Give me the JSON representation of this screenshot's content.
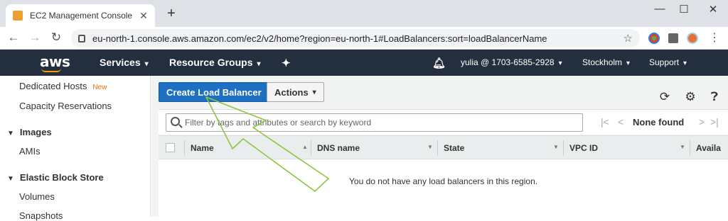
{
  "browser": {
    "tab_title": "EC2 Management Console",
    "tab_close": "✕",
    "new_tab": "+",
    "url": "eu-north-1.console.aws.amazon.com/ec2/v2/home?region=eu-north-1#LoadBalancers:sort=loadBalancerName",
    "window_controls": {
      "minimize": "—",
      "maximize": "☐",
      "close": "✕"
    },
    "nav": {
      "back": "←",
      "forward": "→",
      "reload": "↻"
    }
  },
  "aws_nav": {
    "logo": "aws",
    "services": "Services",
    "resource_groups": "Resource Groups",
    "account": "yulia @ 1703-6585-2928",
    "region": "Stockholm",
    "support": "Support"
  },
  "sidebar": {
    "items": [
      {
        "label": "Dedicated Hosts",
        "badge": "New"
      },
      {
        "label": "Capacity Reservations"
      }
    ],
    "sections": [
      {
        "title": "Images",
        "items": [
          {
            "label": "AMIs"
          }
        ]
      },
      {
        "title": "Elastic Block Store",
        "items": [
          {
            "label": "Volumes"
          },
          {
            "label": "Snapshots"
          }
        ]
      }
    ]
  },
  "toolbar": {
    "create_label": "Create Load Balancer",
    "actions_label": "Actions"
  },
  "filter": {
    "placeholder": "Filter by tags and attributes or search by keyword",
    "pager_text": "None found"
  },
  "table": {
    "columns": [
      "Name",
      "DNS name",
      "State",
      "VPC ID",
      "Availa"
    ],
    "empty_message": "You do not have any load balancers in this region."
  },
  "colors": {
    "aws_nav_bg": "#232f3e",
    "primary_button": "#1d6fc2",
    "aws_orange": "#ff9900",
    "annotation_arrow": "#8cc63f"
  }
}
